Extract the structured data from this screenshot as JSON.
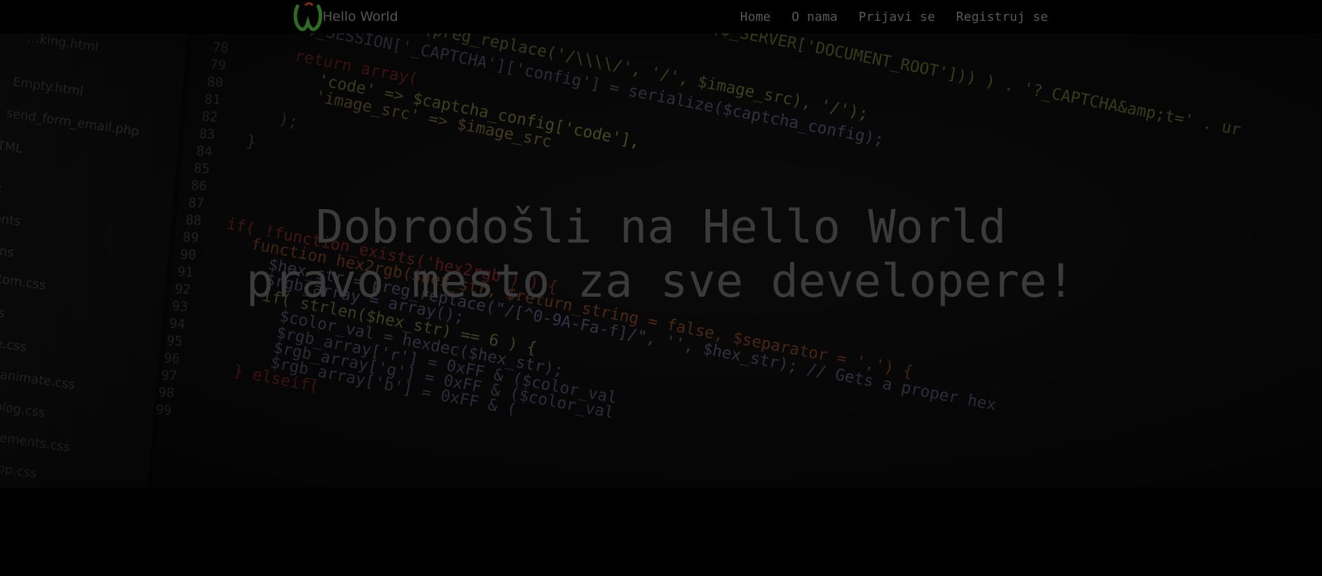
{
  "brand": {
    "name": "Hello World",
    "logo_icon": "hello-world-logo-icon",
    "logo_color": "#3d7a2a"
  },
  "nav": {
    "items": [
      {
        "label": "Home"
      },
      {
        "label": "O nama"
      },
      {
        "label": "Prijavi se"
      },
      {
        "label": "Registruj se"
      }
    ]
  },
  "hero": {
    "title_line1": "Dobrodošli na Hello World",
    "title_line2": "pravo mesto za sve developere!"
  },
  "background": {
    "sidebar_files": [
      "…king.html",
      "Empty.html",
      "send_form_email.php",
      "HTML",
      "css",
      "fonts",
      "skins",
      "custom.css",
      "ie.css",
      "theme.css",
      "theme-animate.css",
      "theme-blog.css",
      "theme-elements.css",
      "theme-shop.css"
    ],
    "line_numbers": [
      "78",
      "79",
      "80",
      "81",
      "82",
      "83",
      "84",
      "85",
      "86",
      "87",
      "88",
      "89",
      "90",
      "91",
      "92",
      "93",
      "94",
      "95",
      "96",
      "97",
      "98",
      "99"
    ],
    "code_lines": [
      "/ . ltrim(preg_replace('/\\\\\\\\/', '/', $image_src), '/');",
      "$_SESSION['_CAPTCHA']['config'] = serialize($captcha_config);",
      "return array(",
      "'code' => $captcha_config['code'],",
      "'image_src' => $image_src",
      ");",
      "}",
      "if( !function_exists('hex2rgb') ) {",
      "function hex2rgb($hex_str, $return_string = false, $separator = ',') {",
      "$hex_str = preg_replace(\"/[^0-9A-Fa-f]/\", '', $hex_str); // Gets a proper hex",
      "$rgb_array = array();",
      "if( strlen($hex_str) == 6 ) {",
      "$color_val = hexdec($hex_str);",
      "$rgb_array['r'] = 0xFF & ($color_val",
      "$rgb_array['g'] = 0xFF & ($color_val",
      "$rgb_array['b'] = 0xFF & (",
      "} elseif("
    ],
    "top_line": "realpath($_SERVER['DOCUMENT_ROOT'])) ) . '?_CAPTCHA&amp;t=' . ur"
  }
}
